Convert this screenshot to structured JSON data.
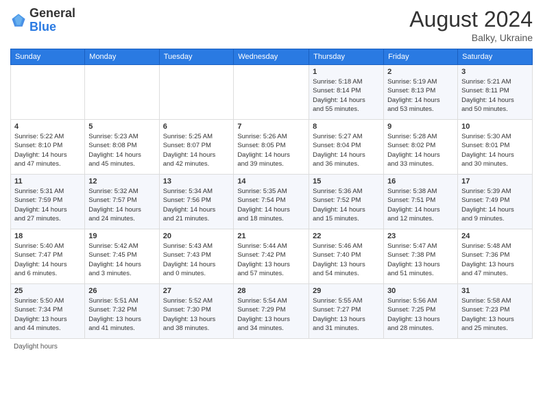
{
  "header": {
    "logo_general": "General",
    "logo_blue": "Blue",
    "month_year": "August 2024",
    "location": "Balky, Ukraine"
  },
  "days_of_week": [
    "Sunday",
    "Monday",
    "Tuesday",
    "Wednesday",
    "Thursday",
    "Friday",
    "Saturday"
  ],
  "weeks": [
    [
      {
        "day": "",
        "info": ""
      },
      {
        "day": "",
        "info": ""
      },
      {
        "day": "",
        "info": ""
      },
      {
        "day": "",
        "info": ""
      },
      {
        "day": "1",
        "info": "Sunrise: 5:18 AM\nSunset: 8:14 PM\nDaylight: 14 hours\nand 55 minutes."
      },
      {
        "day": "2",
        "info": "Sunrise: 5:19 AM\nSunset: 8:13 PM\nDaylight: 14 hours\nand 53 minutes."
      },
      {
        "day": "3",
        "info": "Sunrise: 5:21 AM\nSunset: 8:11 PM\nDaylight: 14 hours\nand 50 minutes."
      }
    ],
    [
      {
        "day": "4",
        "info": "Sunrise: 5:22 AM\nSunset: 8:10 PM\nDaylight: 14 hours\nand 47 minutes."
      },
      {
        "day": "5",
        "info": "Sunrise: 5:23 AM\nSunset: 8:08 PM\nDaylight: 14 hours\nand 45 minutes."
      },
      {
        "day": "6",
        "info": "Sunrise: 5:25 AM\nSunset: 8:07 PM\nDaylight: 14 hours\nand 42 minutes."
      },
      {
        "day": "7",
        "info": "Sunrise: 5:26 AM\nSunset: 8:05 PM\nDaylight: 14 hours\nand 39 minutes."
      },
      {
        "day": "8",
        "info": "Sunrise: 5:27 AM\nSunset: 8:04 PM\nDaylight: 14 hours\nand 36 minutes."
      },
      {
        "day": "9",
        "info": "Sunrise: 5:28 AM\nSunset: 8:02 PM\nDaylight: 14 hours\nand 33 minutes."
      },
      {
        "day": "10",
        "info": "Sunrise: 5:30 AM\nSunset: 8:01 PM\nDaylight: 14 hours\nand 30 minutes."
      }
    ],
    [
      {
        "day": "11",
        "info": "Sunrise: 5:31 AM\nSunset: 7:59 PM\nDaylight: 14 hours\nand 27 minutes."
      },
      {
        "day": "12",
        "info": "Sunrise: 5:32 AM\nSunset: 7:57 PM\nDaylight: 14 hours\nand 24 minutes."
      },
      {
        "day": "13",
        "info": "Sunrise: 5:34 AM\nSunset: 7:56 PM\nDaylight: 14 hours\nand 21 minutes."
      },
      {
        "day": "14",
        "info": "Sunrise: 5:35 AM\nSunset: 7:54 PM\nDaylight: 14 hours\nand 18 minutes."
      },
      {
        "day": "15",
        "info": "Sunrise: 5:36 AM\nSunset: 7:52 PM\nDaylight: 14 hours\nand 15 minutes."
      },
      {
        "day": "16",
        "info": "Sunrise: 5:38 AM\nSunset: 7:51 PM\nDaylight: 14 hours\nand 12 minutes."
      },
      {
        "day": "17",
        "info": "Sunrise: 5:39 AM\nSunset: 7:49 PM\nDaylight: 14 hours\nand 9 minutes."
      }
    ],
    [
      {
        "day": "18",
        "info": "Sunrise: 5:40 AM\nSunset: 7:47 PM\nDaylight: 14 hours\nand 6 minutes."
      },
      {
        "day": "19",
        "info": "Sunrise: 5:42 AM\nSunset: 7:45 PM\nDaylight: 14 hours\nand 3 minutes."
      },
      {
        "day": "20",
        "info": "Sunrise: 5:43 AM\nSunset: 7:43 PM\nDaylight: 14 hours\nand 0 minutes."
      },
      {
        "day": "21",
        "info": "Sunrise: 5:44 AM\nSunset: 7:42 PM\nDaylight: 13 hours\nand 57 minutes."
      },
      {
        "day": "22",
        "info": "Sunrise: 5:46 AM\nSunset: 7:40 PM\nDaylight: 13 hours\nand 54 minutes."
      },
      {
        "day": "23",
        "info": "Sunrise: 5:47 AM\nSunset: 7:38 PM\nDaylight: 13 hours\nand 51 minutes."
      },
      {
        "day": "24",
        "info": "Sunrise: 5:48 AM\nSunset: 7:36 PM\nDaylight: 13 hours\nand 47 minutes."
      }
    ],
    [
      {
        "day": "25",
        "info": "Sunrise: 5:50 AM\nSunset: 7:34 PM\nDaylight: 13 hours\nand 44 minutes."
      },
      {
        "day": "26",
        "info": "Sunrise: 5:51 AM\nSunset: 7:32 PM\nDaylight: 13 hours\nand 41 minutes."
      },
      {
        "day": "27",
        "info": "Sunrise: 5:52 AM\nSunset: 7:30 PM\nDaylight: 13 hours\nand 38 minutes."
      },
      {
        "day": "28",
        "info": "Sunrise: 5:54 AM\nSunset: 7:29 PM\nDaylight: 13 hours\nand 34 minutes."
      },
      {
        "day": "29",
        "info": "Sunrise: 5:55 AM\nSunset: 7:27 PM\nDaylight: 13 hours\nand 31 minutes."
      },
      {
        "day": "30",
        "info": "Sunrise: 5:56 AM\nSunset: 7:25 PM\nDaylight: 13 hours\nand 28 minutes."
      },
      {
        "day": "31",
        "info": "Sunrise: 5:58 AM\nSunset: 7:23 PM\nDaylight: 13 hours\nand 25 minutes."
      }
    ]
  ],
  "footer": {
    "daylight_label": "Daylight hours"
  }
}
